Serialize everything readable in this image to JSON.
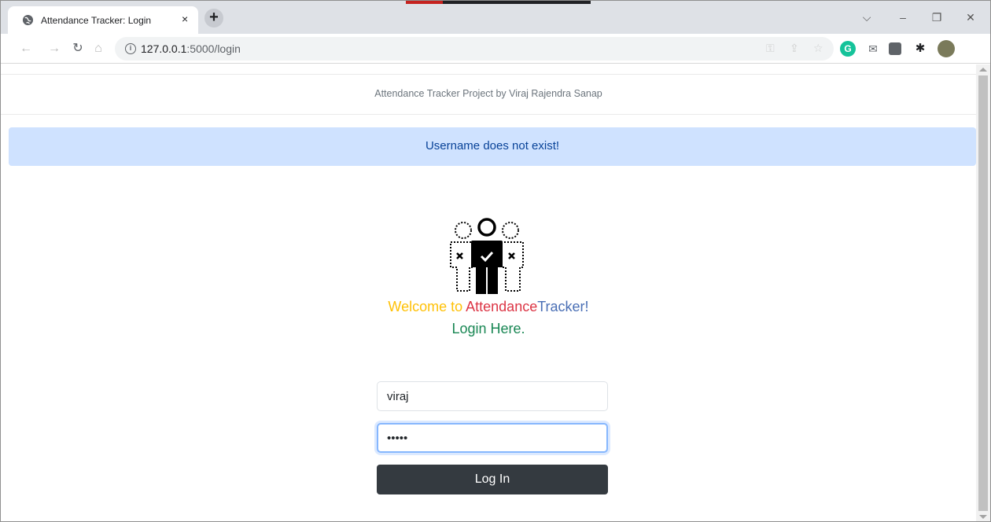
{
  "browser": {
    "tab_title": "Attendance Tracker: Login",
    "tab_close": "×",
    "new_tab": "+",
    "url_host": "127.0.0.1",
    "url_path": ":5000/login",
    "win_minimize": "–",
    "win_restore": "❐",
    "win_close": "✕",
    "win_dropdown": "⌵"
  },
  "page": {
    "credit": "Attendance Tracker Project by Viraj Rajendra Sanap",
    "alert": "Username does not exist!",
    "welcome_prefix": "Welcome to ",
    "welcome_brand_a": "Attendance",
    "welcome_brand_b": "Tracker!",
    "login_heading": "Login Here.",
    "username_value": "viraj",
    "password_value": "•••••",
    "login_button": "Log In"
  },
  "colors": {
    "alert_bg": "#cfe2ff",
    "alert_text": "#084298",
    "welcome_yellow": "#ffc107",
    "welcome_red": "#dc3545",
    "welcome_blue": "#4a6fb5",
    "login_green": "#198754",
    "button_bg": "#343a40"
  }
}
